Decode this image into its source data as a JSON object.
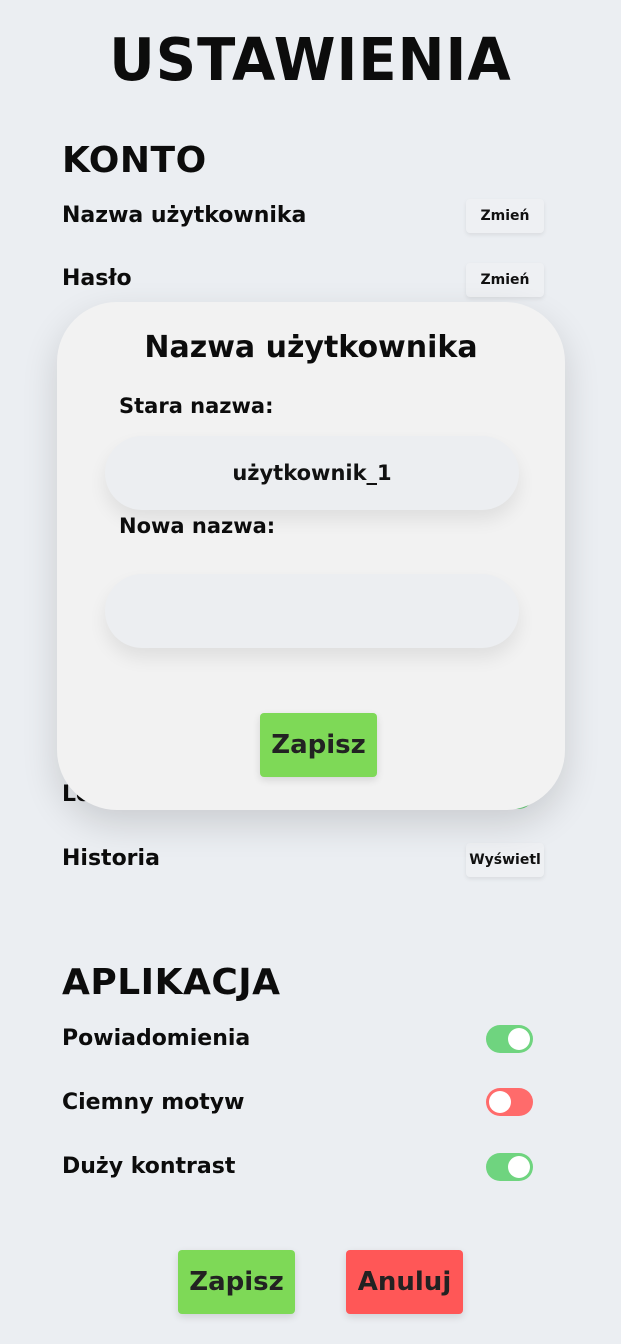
{
  "page": {
    "title": "USTAWIENIA"
  },
  "account": {
    "heading": "KONTO",
    "username_label": "Nazwa użytkownika",
    "username_button": "Zmień",
    "password_label": "Hasło",
    "password_button": "Zmień",
    "location_label": "Lok",
    "location_toggle": true,
    "history_label": "Historia",
    "history_button": "Wyświetl"
  },
  "app": {
    "heading": "APLIKACJA",
    "notifications_label": "Powiadomienia",
    "notifications_on": true,
    "dark_theme_label": "Ciemny motyw",
    "dark_theme_on": false,
    "high_contrast_label": "Duży kontrast",
    "high_contrast_on": true
  },
  "footer": {
    "save_label": "Zapisz",
    "cancel_label": "Anuluj"
  },
  "modal": {
    "title": "Nazwa użytkownika",
    "old_label": "Stara nazwa:",
    "old_value": "użytkownik_1",
    "new_label": "Nowa nazwa:",
    "new_value": "",
    "save_label": "Zapisz"
  },
  "colors": {
    "background": "#ebeef2",
    "toggle_on": "#6fd47f",
    "toggle_off": "#ff6b6b",
    "save_button": "#7ed957",
    "cancel_button": "#ff5757"
  },
  "icons": [
    "toggle-switch"
  ]
}
